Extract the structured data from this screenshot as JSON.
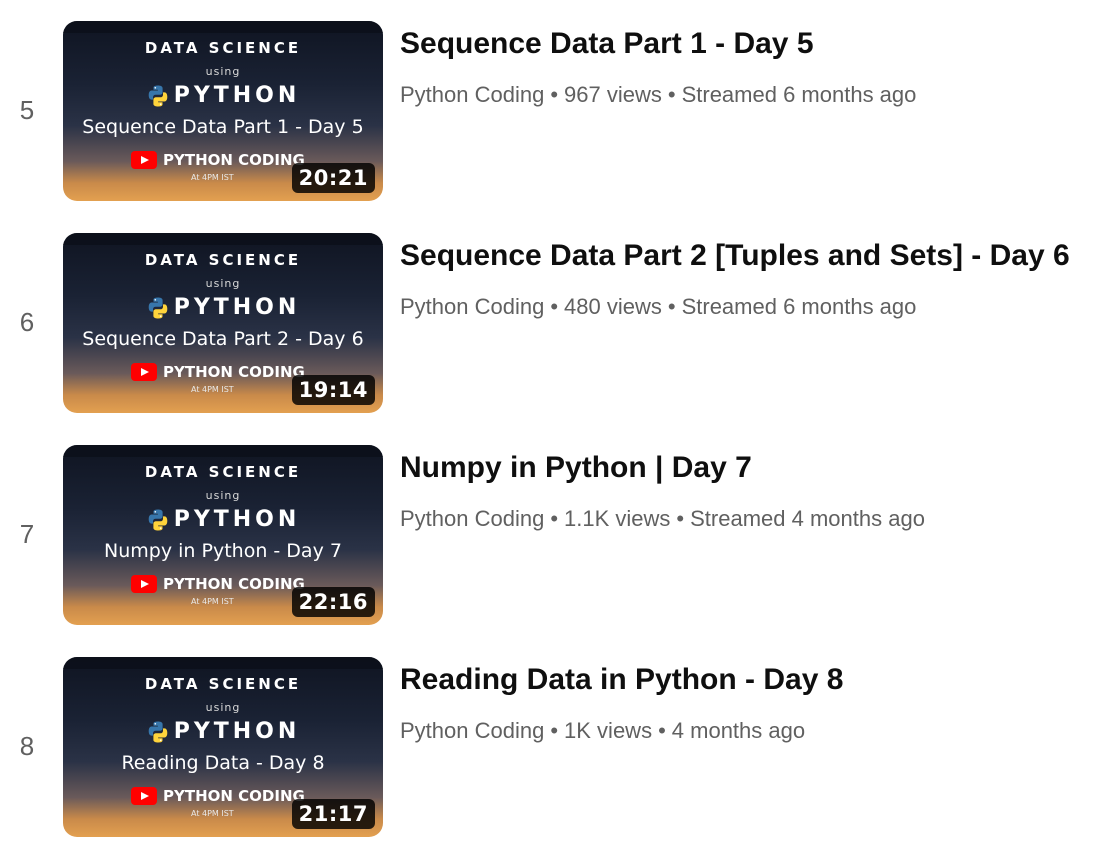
{
  "playlist": {
    "items": [
      {
        "index": "5",
        "title": "Sequence Data Part 1 - Day 5",
        "channel": "Python Coding",
        "views": "967 views",
        "age": "Streamed 6 months ago",
        "duration": "20:21",
        "thumb": {
          "header": "DATA SCIENCE",
          "using": "using",
          "python": "PYTHON",
          "topic": "Sequence Data Part 1 - Day 5",
          "channel": "PYTHON CODING",
          "time": "At 4PM IST"
        }
      },
      {
        "index": "6",
        "title": "Sequence Data Part 2 [Tuples and Sets] - Day 6",
        "channel": "Python Coding",
        "views": "480 views",
        "age": "Streamed 6 months ago",
        "duration": "19:14",
        "thumb": {
          "header": "DATA SCIENCE",
          "using": "using",
          "python": "PYTHON",
          "topic": "Sequence Data Part 2 - Day 6",
          "channel": "PYTHON CODING",
          "time": "At 4PM IST"
        }
      },
      {
        "index": "7",
        "title": "Numpy in Python | Day 7",
        "channel": "Python Coding",
        "views": "1.1K views",
        "age": "Streamed 4 months ago",
        "duration": "22:16",
        "thumb": {
          "header": "DATA SCIENCE",
          "using": "using",
          "python": "PYTHON",
          "topic": "Numpy in Python - Day 7",
          "channel": "PYTHON CODING",
          "time": "At 4PM IST"
        }
      },
      {
        "index": "8",
        "title": "Reading Data in Python - Day 8",
        "channel": "Python Coding",
        "views": "1K views",
        "age": "4 months ago",
        "duration": "21:17",
        "thumb": {
          "header": "DATA SCIENCE",
          "using": "using",
          "python": "PYTHON",
          "topic": "Reading Data - Day 8",
          "channel": "PYTHON CODING",
          "time": "At 4PM IST"
        }
      }
    ],
    "separator": "•"
  },
  "colors": {
    "title": "#0f0f0f",
    "meta": "#606060",
    "youtube_red": "#ff0000",
    "python_blue": "#3776ab",
    "python_yellow": "#ffd43b"
  },
  "icons": {
    "python_logo": "python-logo-icon",
    "youtube_logo": "youtube-logo-icon"
  }
}
